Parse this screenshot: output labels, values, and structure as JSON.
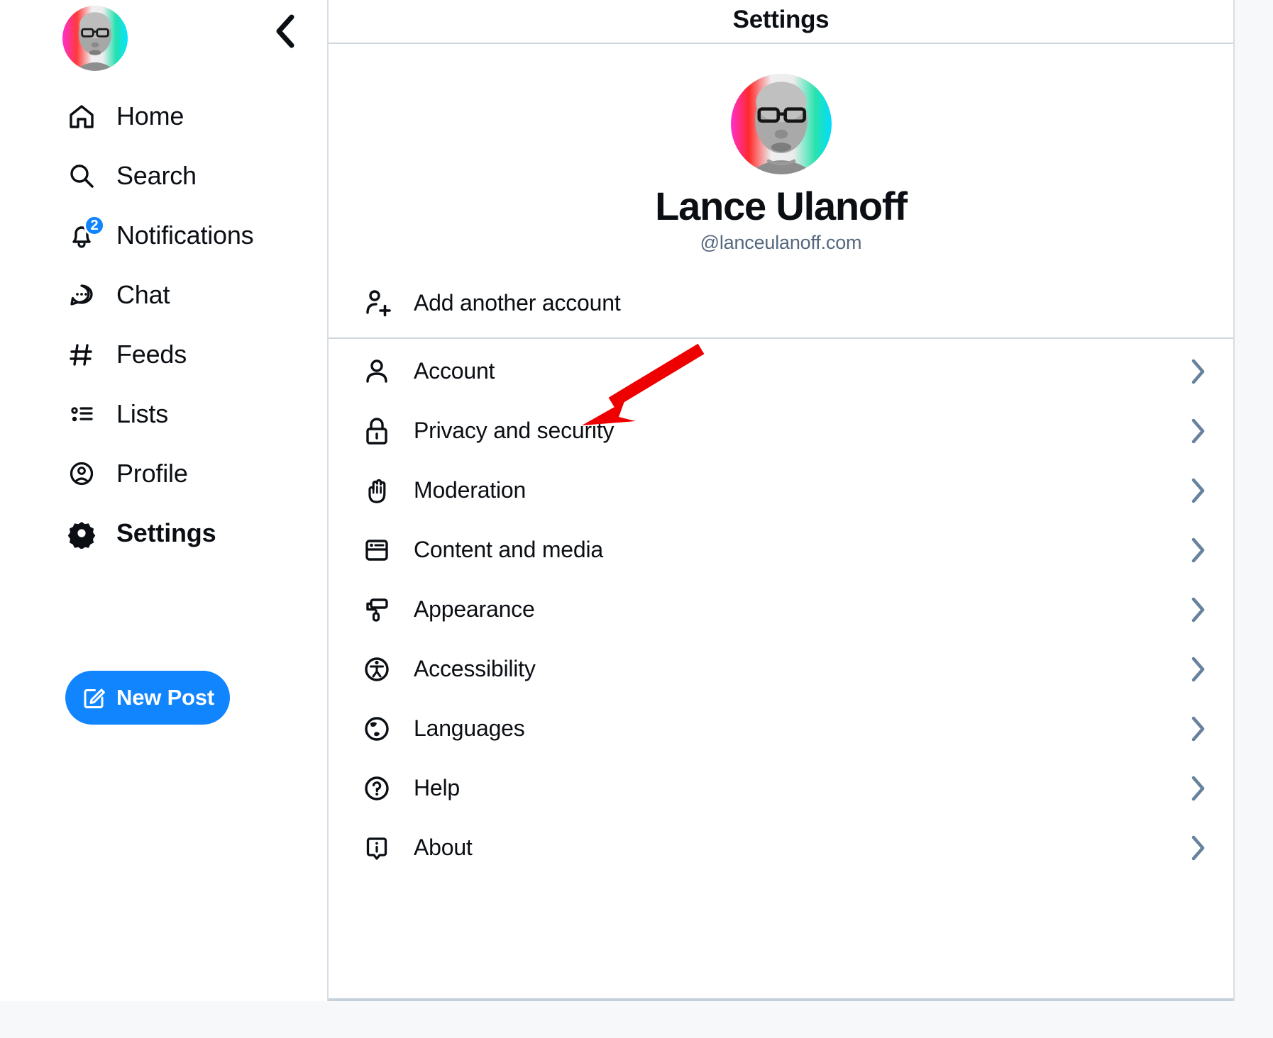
{
  "app": {
    "accent_color": "#1185fe",
    "chevron_color": "#66829e",
    "annotation_color": "#ee0000",
    "divider_color": "#ced6de"
  },
  "sidebar": {
    "avatar_alt": "Lance Ulanoff avatar",
    "collapse_icon": "chevron-left-icon",
    "items": [
      {
        "label": "Home",
        "icon": "home-icon",
        "active": false,
        "badge": ""
      },
      {
        "label": "Search",
        "icon": "search-icon",
        "active": false,
        "badge": ""
      },
      {
        "label": "Notifications",
        "icon": "bell-icon",
        "active": false,
        "badge": "2"
      },
      {
        "label": "Chat",
        "icon": "chat-bubble-icon",
        "active": false,
        "badge": ""
      },
      {
        "label": "Feeds",
        "icon": "hashtag-icon",
        "active": false,
        "badge": ""
      },
      {
        "label": "Lists",
        "icon": "list-icon",
        "active": false,
        "badge": ""
      },
      {
        "label": "Profile",
        "icon": "user-circle-icon",
        "active": false,
        "badge": ""
      },
      {
        "label": "Settings",
        "icon": "gear-icon",
        "active": true,
        "badge": ""
      }
    ],
    "new_post": {
      "label": "New Post",
      "icon": "compose-icon"
    }
  },
  "main": {
    "header": {
      "title": "Settings"
    },
    "profile": {
      "name": "Lance Ulanoff",
      "handle": "@lanceulanoff.com",
      "avatar_alt": "Lance Ulanoff avatar"
    },
    "add_account": {
      "label": "Add another account",
      "icon": "user-plus-icon"
    },
    "settings_rows": [
      {
        "label": "Account",
        "icon": "person-icon",
        "chevron": "chevron-right-icon"
      },
      {
        "label": "Privacy and security",
        "icon": "lock-icon",
        "chevron": "chevron-right-icon"
      },
      {
        "label": "Moderation",
        "icon": "raised-hand-icon",
        "chevron": "chevron-right-icon"
      },
      {
        "label": "Content and media",
        "icon": "window-card-icon",
        "chevron": "chevron-right-icon"
      },
      {
        "label": "Appearance",
        "icon": "paint-roller-icon",
        "chevron": "chevron-right-icon"
      },
      {
        "label": "Accessibility",
        "icon": "accessibility-icon",
        "chevron": "chevron-right-icon"
      },
      {
        "label": "Languages",
        "icon": "globe-icon",
        "chevron": "chevron-right-icon"
      },
      {
        "label": "Help",
        "icon": "question-circle-icon",
        "chevron": "chevron-right-icon"
      },
      {
        "label": "About",
        "icon": "info-bubble-icon",
        "chevron": "chevron-right-icon"
      }
    ]
  },
  "annotation": {
    "type": "arrow",
    "points_to": "Account",
    "color": "#ee0000"
  }
}
